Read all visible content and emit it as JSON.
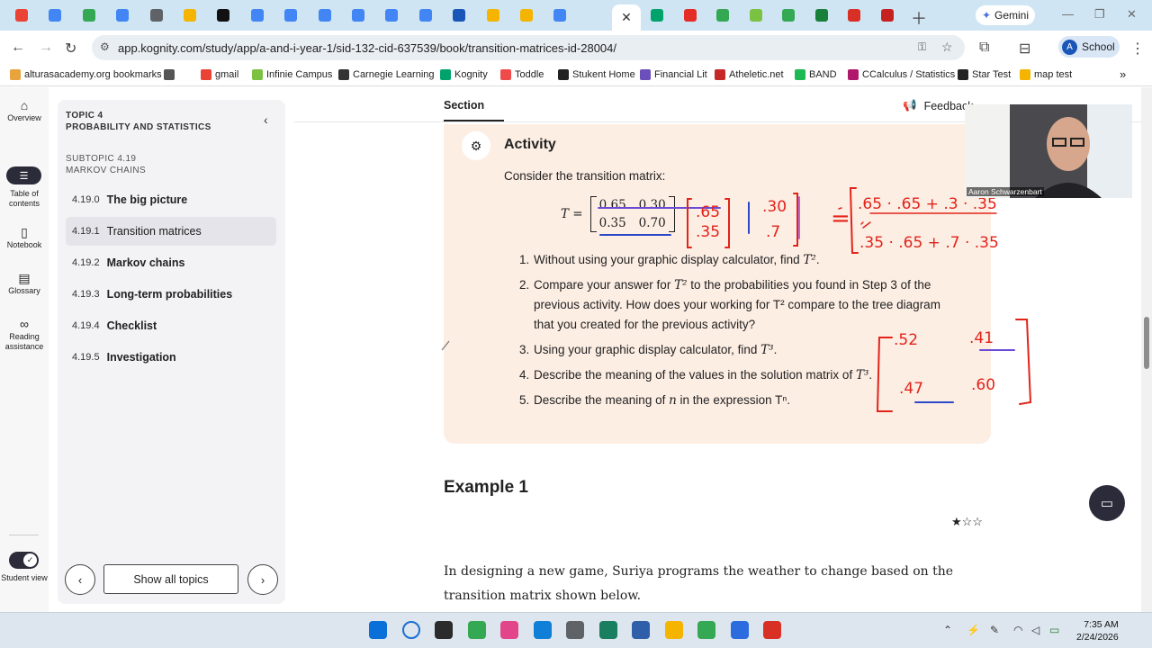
{
  "browser": {
    "url": "app.kognity.com/study/app/a-and-i-year-1/sid-132-cid-637539/book/transition-matrices-id-28004/",
    "gemini_label": "Gemini",
    "profile_initial": "A",
    "profile_label": "School",
    "tab_favicon_colors": [
      "#ea4335",
      "#4285f4",
      "#34a853",
      "#4285f4",
      "#5f6368",
      "#f4b400",
      "#111111",
      "#4285f4",
      "#4285f4",
      "#4285f4",
      "#4285f4",
      "#4285f4",
      "#4285f4",
      "#1a56b8",
      "#f4b400",
      "#f4b400",
      "#4285f4"
    ],
    "right_tab_colors": [
      "#00a36c",
      "#e52d27",
      "#34a853",
      "#7cc242",
      "#34a853",
      "#188038",
      "#d93025",
      "#c5221f"
    ],
    "bookmarks": [
      {
        "label": "alturasacademy.org bookmarks",
        "color": "#e8a33d"
      },
      {
        "label": "",
        "color": "#555555"
      },
      {
        "label": "gmail",
        "color": "#ea4335"
      },
      {
        "label": "Infinie Campus",
        "color": "#7cc242"
      },
      {
        "label": "Carnegie Learning",
        "color": "#333333"
      },
      {
        "label": "Kognity",
        "color": "#00a36c"
      },
      {
        "label": "Toddle",
        "color": "#ef4b4b"
      },
      {
        "label": "Stukent Home",
        "color": "#222222"
      },
      {
        "label": "Financial Lit",
        "color": "#6b4fbb"
      },
      {
        "label": "Atheletic.net",
        "color": "#c62828"
      },
      {
        "label": "BAND",
        "color": "#1db954"
      },
      {
        "label": "CCalculus / Statistics",
        "color": "#b0186b"
      },
      {
        "label": "Star Test",
        "color": "#222222"
      },
      {
        "label": "map test",
        "color": "#f4b400"
      }
    ]
  },
  "rail": {
    "overview": "Overview",
    "toc": "Table of contents",
    "notebook": "Notebook",
    "glossary": "Glossary",
    "reading": "Reading assistance",
    "student_view": "Student view"
  },
  "toc": {
    "topic_label": "TOPIC 4",
    "topic_title": "PROBABILITY AND STATISTICS",
    "subtopic_label": "SUBTOPIC 4.19",
    "subtopic_title": "MARKOV CHAINS",
    "items": [
      {
        "num": "4.19.0",
        "title": "The big picture"
      },
      {
        "num": "4.19.1",
        "title": "Transition matrices"
      },
      {
        "num": "4.19.2",
        "title": "Markov chains"
      },
      {
        "num": "4.19.3",
        "title": "Long-term probabilities"
      },
      {
        "num": "4.19.4",
        "title": "Checklist"
      },
      {
        "num": "4.19.5",
        "title": "Investigation"
      }
    ],
    "show_all": "Show all topics"
  },
  "main": {
    "section_tab": "Section",
    "feedback": "Feedback",
    "activity": {
      "title": "Activity",
      "intro": "Consider the transition matrix:",
      "matrix_label": "T =",
      "matrix": [
        "0.65",
        "0.30",
        "0.35",
        "0.70"
      ],
      "steps": [
        {
          "n": "1.",
          "pre": "Without using your graphic display calculator, find ",
          "math": "T²",
          "post": "."
        },
        {
          "n": "2.",
          "pre": "Compare your answer for ",
          "math": "T²",
          "post": " to the probabilities you found in Step 3 of the previous activity. How does your working for T² compare to the tree diagram that you created for the previous activity?"
        },
        {
          "n": "3.",
          "pre": "Using your graphic display calculator, find ",
          "math": "T³",
          "post": "."
        },
        {
          "n": "4.",
          "pre": "Describe the meaning of the values in the solution matrix of ",
          "math": "T³",
          "post": "."
        },
        {
          "n": "5.",
          "pre": "Describe the meaning of ",
          "math": "n",
          "post": " in the expression Tⁿ."
        }
      ]
    },
    "annotations": {
      "m1": [
        ".65",
        ".35"
      ],
      "m2": [
        ".30",
        ".7"
      ],
      "row1": ".65 · .65 + .3 · .35",
      "row2": ".35 · .65 + .7 · .35",
      "r3": [
        ".52",
        ".41",
        ".47",
        ".60"
      ]
    },
    "example_title": "Example 1",
    "difficulty_stars": "★☆☆",
    "example_text": "In designing a new game, Suriya programs the weather to change based on the transition matrix shown below."
  },
  "video": {
    "name": "Aaron Schwarzenbart"
  },
  "taskbar": {
    "time": "7:35 AM",
    "date": "2/24/2026",
    "icon_colors": [
      "#0a6fd8",
      "#1c6fd1",
      "#2b2b2b",
      "#34a853",
      "#e3458a",
      "#0f7fd8",
      "#5f6368",
      "#1a7f5e",
      "#2f5fa8",
      "#f4b400",
      "#34a853",
      "#2d6cdf",
      "#d93025"
    ]
  }
}
